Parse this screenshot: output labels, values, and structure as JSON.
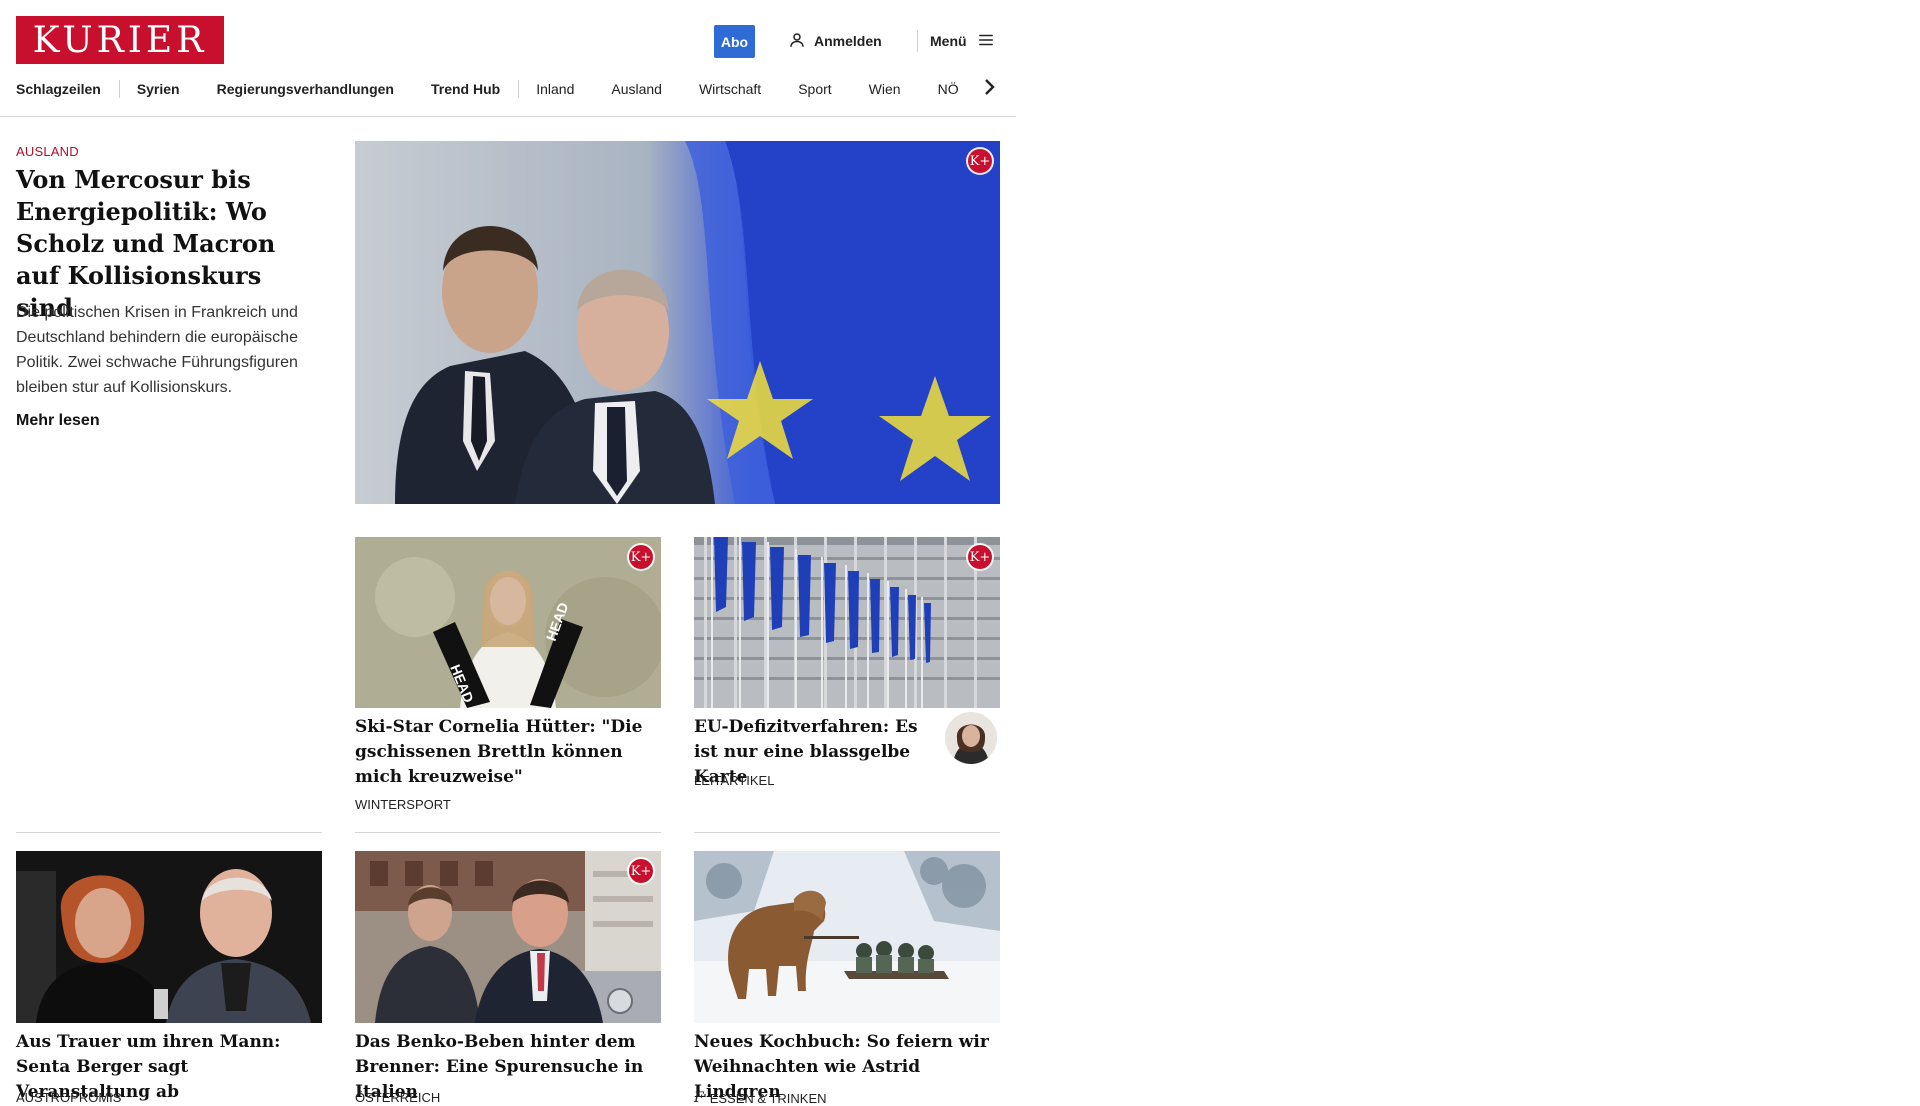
{
  "brand": {
    "name": "KURIER",
    "color": "#c8102e"
  },
  "header": {
    "abo_label": "Abo",
    "login_label": "Anmelden",
    "menu_label": "Menü"
  },
  "nav": {
    "items": [
      "Schlagzeilen",
      "Syrien",
      "Regierungsverhandlungen",
      "Trend Hub",
      "Inland",
      "Ausland",
      "Wirtschaft",
      "Sport",
      "Wien",
      "NÖ"
    ]
  },
  "lead": {
    "kicker": "AUSLAND",
    "title": "Von Mercosur bis Ener­giepolitik: Wo Scholz und Macron auf Kollisions­kurs sind",
    "teaser": "Die politischen Krisen in Frankreich und Deutschland behindern die europäische Politik. Zwei schwache Führungsfiguren bleiben stur auf Kollisionskurs.",
    "more_label": "Mehr lesen",
    "premium_badge": "K+"
  },
  "cards": [
    {
      "title": "Ski-Star Cornelia Hütter: \"Die gschissenen Brettln können mich kreuzweise\"",
      "kicker": "WINTERSPORT",
      "premium_badge": "K+"
    },
    {
      "title": "EU-Defizitverfahren: Es ist nur eine blassgelbe Karte",
      "kicker": "LEITARTIKEL",
      "premium_badge": "K+"
    },
    {
      "title": "Aus Trauer um ihren Mann: Senta Berger sagt Veranstaltung ab",
      "kicker": "AUSTROPROMIS"
    },
    {
      "title": "Das Benko-Beben hinter dem Bren­ner: Eine Spurensuche in Italien",
      "kicker": "ÖSTERREICH",
      "premium_badge": "K+"
    },
    {
      "title": "Neues Kochbuch: So feiern wir Weihnachten wie Astrid Lindgren",
      "kicker": "ESSEN & TRINKEN",
      "kicker_icon": "f"
    }
  ],
  "colors": {
    "accent_blue": "#2f6bd4",
    "kicker_red": "#b0102a",
    "eu_blue": "#1f3fb8",
    "eu_star": "#f3e13a"
  }
}
